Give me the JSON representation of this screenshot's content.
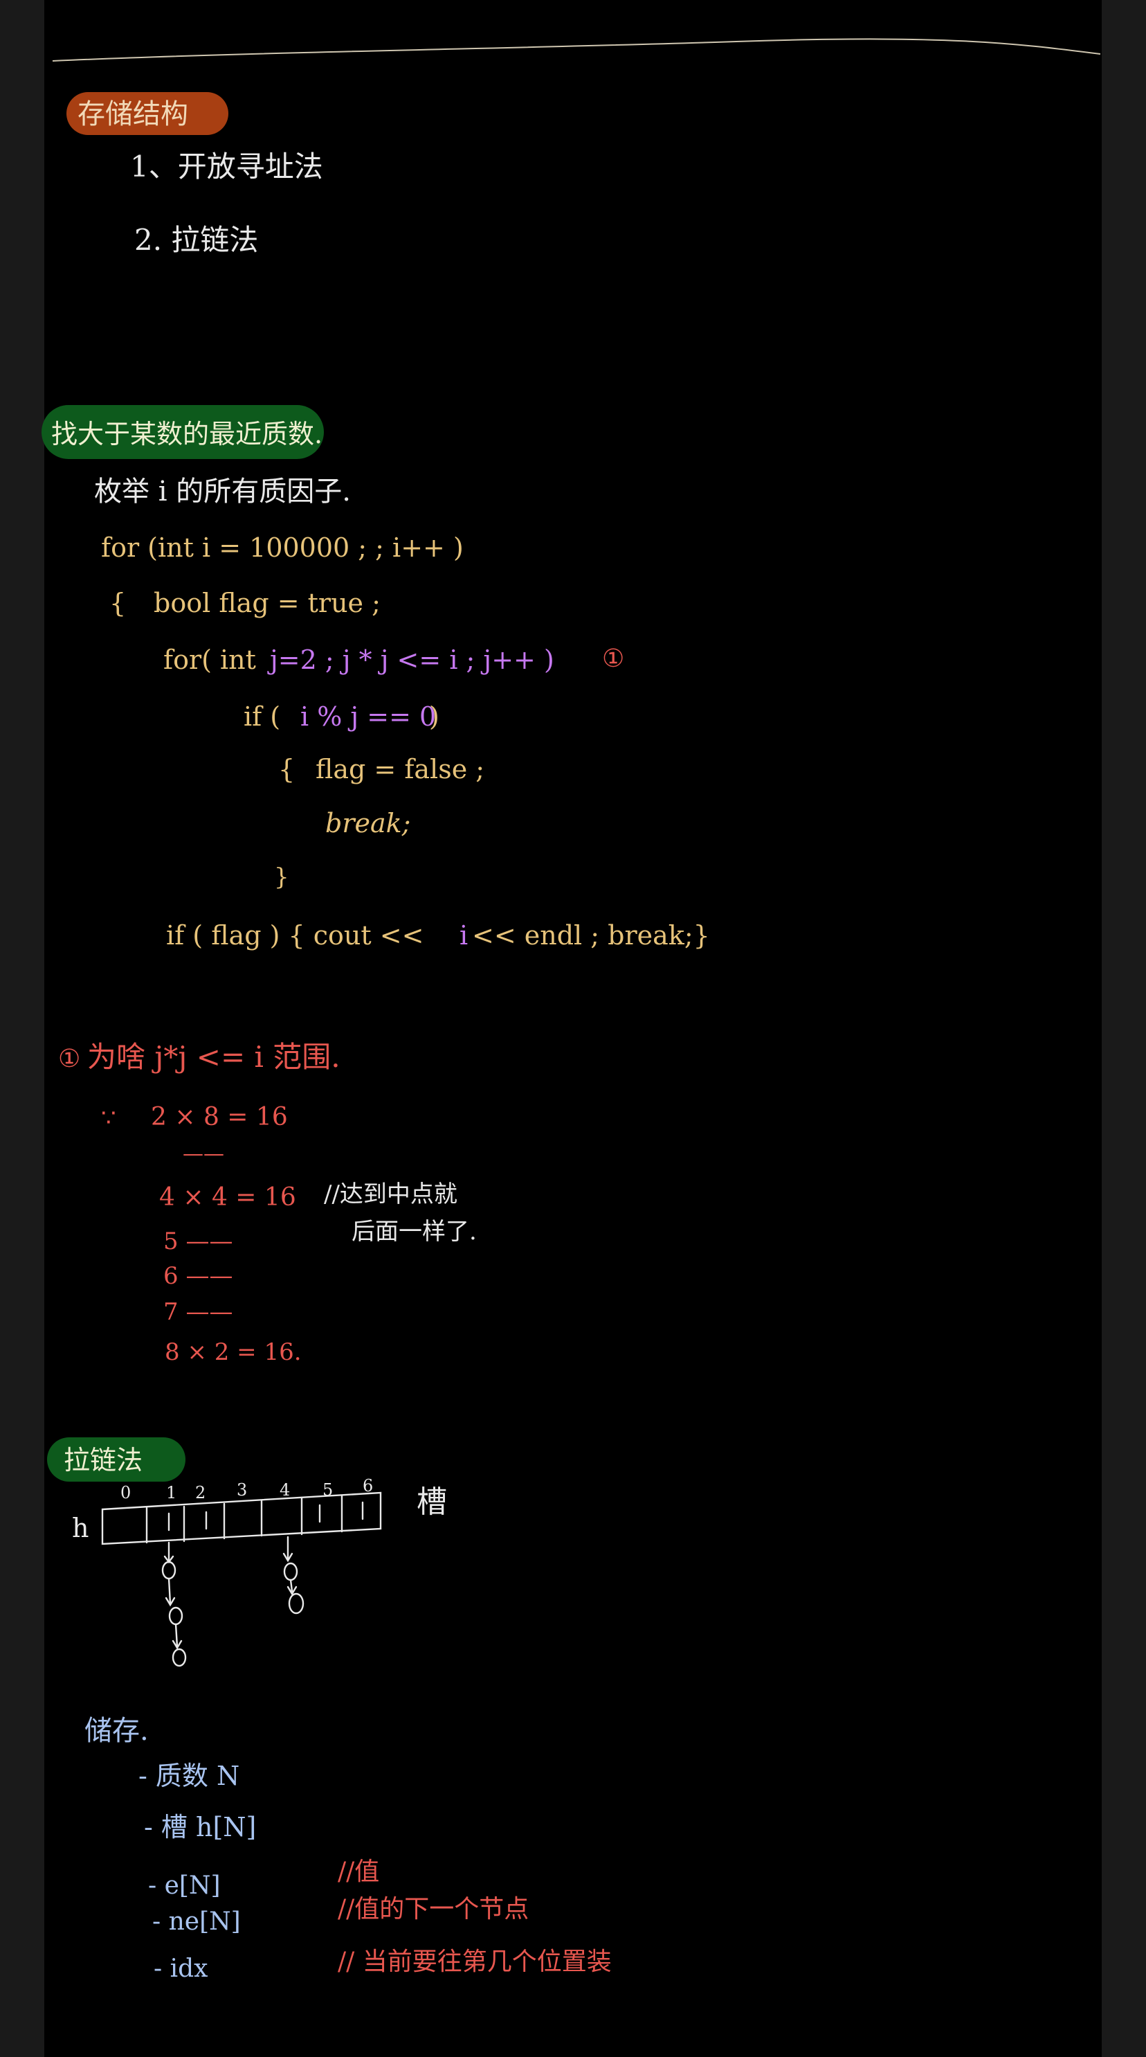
{
  "section1": {
    "title": "存储结构",
    "items": [
      "1、开放寻址法",
      "2. 拉链法"
    ]
  },
  "section2": {
    "title": "找大于某数的最近质数.",
    "note": "枚举 i 的所有质因子.",
    "code": {
      "line1": "for (int i = 100000 ; ; i++ )",
      "line2_brace": "{",
      "line2": "bool flag = true ;",
      "line3_a": "for( int",
      "line3_b": "j=2 ;  j * j  <= i ;  j++ )",
      "line3_mark": "①",
      "line4_a": "if (",
      "line4_b": "i % j == 0",
      "line4_c": ")",
      "line5_brace": "{",
      "line5": "flag = false ;",
      "line6": "break;",
      "line7": "}",
      "line8_a": "if ( flag ) {  cout << ",
      "line8_b": "i",
      "line8_c": " << endl ;    break;}"
    }
  },
  "section3": {
    "heading_mark": "①",
    "heading": "为啥 j*j <= i 范围.",
    "because": "∵",
    "rows": [
      {
        "expr": "2 × 8  = 16",
        "comment": ""
      },
      {
        "expr": "——",
        "comment": ""
      },
      {
        "expr": "4 × 4   = 16",
        "comment": "//达到中点就"
      },
      {
        "expr": "",
        "comment": "后面一样了."
      },
      {
        "expr": "5 ——",
        "comment": ""
      },
      {
        "expr": "6 ——",
        "comment": ""
      },
      {
        "expr": "7 ——",
        "comment": ""
      },
      {
        "expr": "8 × 2   = 16.",
        "comment": ""
      }
    ]
  },
  "section4": {
    "title": "拉链法",
    "row_label": "h",
    "slot_label": "槽",
    "indices": [
      "0",
      "1",
      "2",
      "3",
      "4",
      "5",
      "6"
    ]
  },
  "section5": {
    "title": "储存.",
    "items": [
      {
        "label": "- 质数  N",
        "comment": ""
      },
      {
        "label": "- 槽  h[N]",
        "comment": ""
      },
      {
        "label": "- e[N]",
        "comment": "//值"
      },
      {
        "label": "- ne[N]",
        "comment": "//值的下一个节点"
      },
      {
        "label": "- idx",
        "comment": "// 当前要往第几个位置装"
      }
    ]
  },
  "colors": {
    "background": "#000000",
    "gutter": "#1a1a1a",
    "white_ink": "#e9e9e9",
    "yellow_ink": "#e7c37a",
    "purple_ink": "#c678f0",
    "red_ink": "#e8574f",
    "blue_ink": "#a9c4f0",
    "highlight_orange": "#a83f12",
    "highlight_green": "#0d5a1c"
  }
}
